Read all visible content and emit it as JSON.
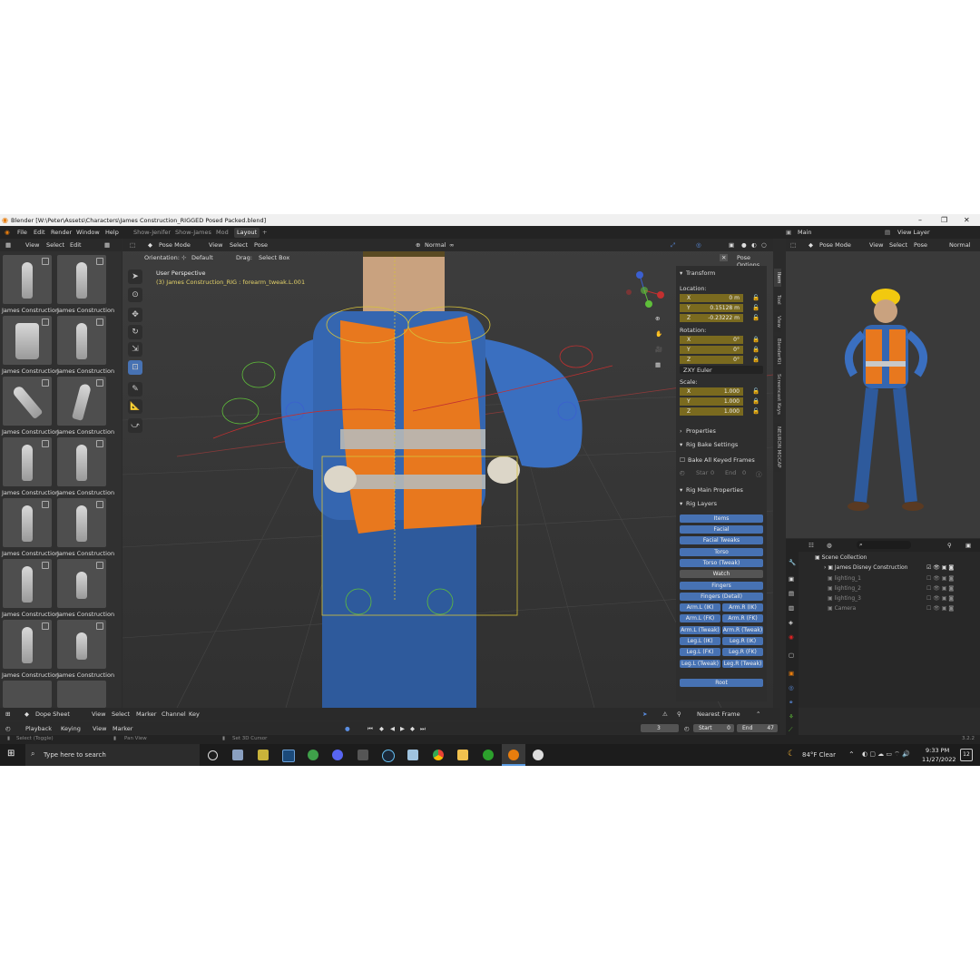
{
  "window": {
    "title": "Blender [W:\\Peter\\Assets\\Characters\\James Construction_RIGGED Posed Packed.blend]"
  },
  "menu": {
    "items": [
      "File",
      "Edit",
      "Render",
      "Window",
      "Help"
    ],
    "workspaces": [
      "Show-Jenifer",
      "Show-James",
      "Mod",
      "Layout"
    ],
    "active_workspace": "Layout",
    "scene": "Main",
    "view_layer": "View Layer"
  },
  "asset_browser": {
    "menu": [
      "View",
      "Select",
      "Edit"
    ],
    "item_label": "James Construction",
    "items": [
      "James Construction",
      "James Construction",
      "James Construction",
      "James Construction",
      "James Construction",
      "James Construction",
      "James Construction",
      "James Construction",
      "James Construction",
      "James Construction",
      "James Construction",
      "James Construction",
      "James Construction",
      "James Construction"
    ]
  },
  "viewport": {
    "mode": "Pose Mode",
    "menu": [
      "View",
      "Select",
      "Pose"
    ],
    "shading": "Normal",
    "orientation_label": "Orientation:",
    "orientation": "Default",
    "drag_label": "Drag:",
    "drag": "Select Box",
    "pose_options": "Pose Options",
    "perspective": "User Perspective",
    "active_info": "(3) James Construction_RIG : forearm_tweak.L.001"
  },
  "npanel": {
    "transform": "Transform",
    "location_label": "Location:",
    "location": [
      {
        "k": "X",
        "v": "0 m"
      },
      {
        "k": "Y",
        "v": "0.15128 m"
      },
      {
        "k": "Z",
        "v": "-0.23222 m"
      }
    ],
    "rotation_label": "Rotation:",
    "rotation": [
      {
        "k": "X",
        "v": "0°"
      },
      {
        "k": "Y",
        "v": "0°"
      },
      {
        "k": "Z",
        "v": "0°"
      }
    ],
    "rotation_mode": "ZXY Euler",
    "scale_label": "Scale:",
    "scale": [
      {
        "k": "X",
        "v": "1.000"
      },
      {
        "k": "Y",
        "v": "1.000"
      },
      {
        "k": "Z",
        "v": "1.000"
      }
    ],
    "properties": "Properties",
    "rig_bake": "Rig Bake Settings",
    "bake_all": "Bake All Keyed Frames",
    "start": "Star",
    "start_val": "0",
    "end": "End",
    "end_val": "0",
    "rig_main": "Rig Main Properties",
    "rig_layers": "Rig Layers",
    "layers_full": [
      "Items",
      "Facial",
      "Facial Tweaks",
      "Torso",
      "Torso (Tweak)",
      "Watch",
      "Fingers",
      "Fingers (Detail)"
    ],
    "layers_pairs": [
      [
        "Arm.L (IK)",
        "Arm.R (IK)"
      ],
      [
        "Arm.L (FK)",
        "Arm.R (FK)"
      ],
      [
        "Arm.L (Tweak)",
        "Arm.R (Tweak)"
      ],
      [
        "Leg.L (IK)",
        "Leg.R (IK)"
      ],
      [
        "Leg.L (FK)",
        "Leg.R (FK)"
      ],
      [
        "Leg.L (Tweak)",
        "Leg.R (Tweak)"
      ]
    ],
    "root": "Root",
    "tabs": [
      "Item",
      "Tool",
      "View",
      "BlenderKit",
      "Screencast Keys",
      "NEURON MOCAP"
    ]
  },
  "right_viewport": {
    "mode": "Pose Mode",
    "menu": [
      "View",
      "Select",
      "Pose"
    ],
    "shading": "Normal"
  },
  "outliner": {
    "root": "Scene Collection",
    "rows": [
      "James Disney Construction",
      "lighting_1",
      "lighting_2",
      "lighting_3",
      "Camera"
    ]
  },
  "dopesheet": {
    "editor": "Dope Sheet",
    "menu": [
      "View",
      "Select",
      "Marker",
      "Channel",
      "Key"
    ],
    "snap": "Nearest Frame"
  },
  "timeline": {
    "menu": [
      "Playback",
      "Keying",
      "View",
      "Marker"
    ],
    "current_frame": "3",
    "start_label": "Start",
    "start": "0",
    "end_label": "End",
    "end": "47"
  },
  "statusbar": {
    "select": "Select (Toggle)",
    "pan": "Pan View",
    "cursor": "Set 3D Cursor",
    "version": "3.2.2"
  },
  "taskbar": {
    "search": "Type here to search",
    "weather": "84°F  Clear",
    "time": "9:33 PM",
    "date": "11/27/2022",
    "notif": "12"
  },
  "colors": {
    "accent": "#4772b3",
    "field": "#7a6a1f",
    "bg": "#2b2b2b"
  }
}
